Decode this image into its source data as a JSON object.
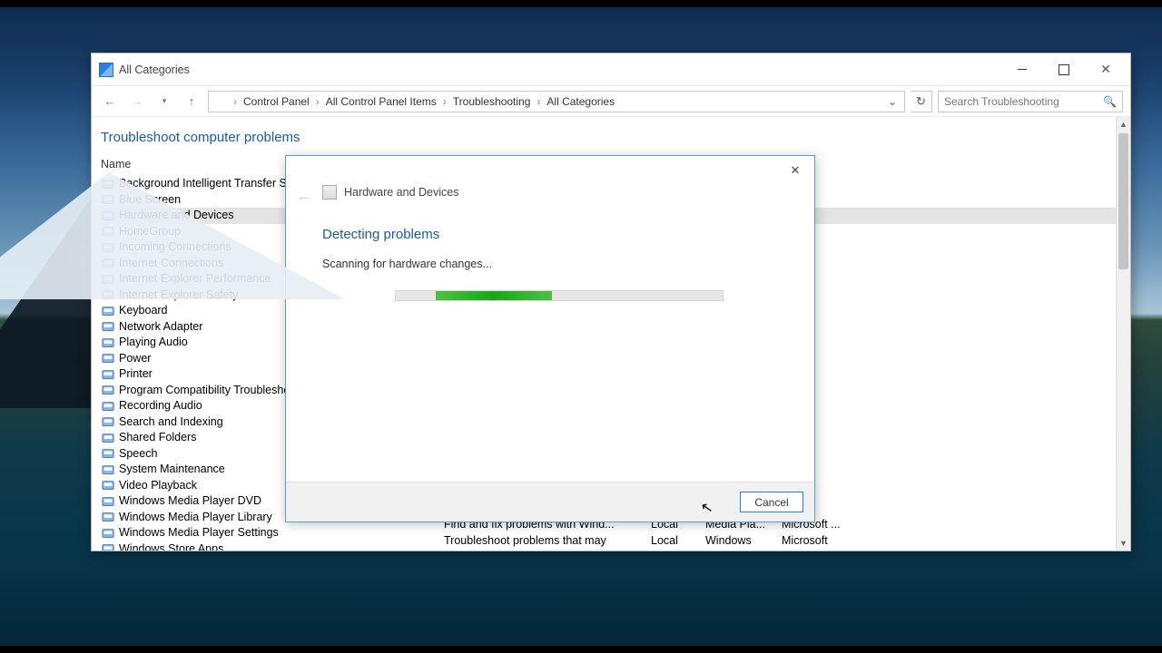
{
  "window": {
    "title": "All Categories",
    "breadcrumbs": [
      "Control Panel",
      "All Control Panel Items",
      "Troubleshooting",
      "All Categories"
    ],
    "search_placeholder": "Search Troubleshooting"
  },
  "page": {
    "heading": "Troubleshoot computer problems",
    "column_header": "Name"
  },
  "items": [
    "Background Intelligent Transfer Se",
    "Blue Screen",
    "Hardware and Devices",
    "HomeGroup",
    "Incoming Connections",
    "Internet Connections",
    "Internet Explorer Performance",
    "Internet Explorer Safety",
    "Keyboard",
    "Network Adapter",
    "Playing Audio",
    "Power",
    "Printer",
    "Program Compatibility Troublesho",
    "Recording Audio",
    "Search and Indexing",
    "Shared Folders",
    "Speech",
    "System Maintenance",
    "Video Playback",
    "Windows Media Player DVD",
    "Windows Media Player Library",
    "Windows Media Player Settings",
    "Windows Store Apps"
  ],
  "selected_index": 2,
  "bottom_rows": {
    "desc": [
      "Find and fix problems with Wind...",
      "Troubleshoot problems that may"
    ],
    "loc": [
      "Local",
      "Local"
    ],
    "cat": [
      "Media Pla...",
      "Windows"
    ],
    "pub": [
      "Microsoft ...",
      "Microsoft"
    ]
  },
  "dialog": {
    "title": "Hardware and Devices",
    "section": "Detecting problems",
    "status": "Scanning for hardware changes...",
    "cancel": "Cancel"
  }
}
